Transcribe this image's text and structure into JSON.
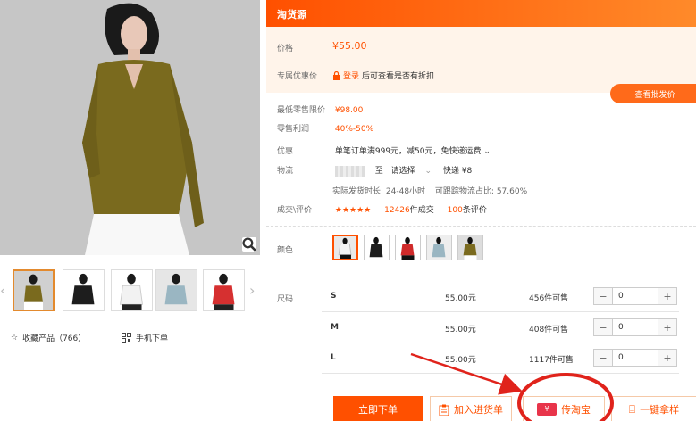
{
  "product": {
    "source_title": "淘货源",
    "price_label": "价格",
    "price": "¥55.00",
    "promo_label": "专属优惠价",
    "login_link": "登录",
    "login_hint": "后可查看是否有折扣",
    "wholesale_button": "查看批发价",
    "min_retail_label": "最低零售限价",
    "min_retail": "¥98.00",
    "margin_label": "零售利润",
    "margin": "40%-50%",
    "discount_label": "优惠",
    "discount_text": "单笔订单满999元，减50元，免快递运费",
    "shipping_label": "物流",
    "shipping_to": "至",
    "shipping_select": "请选择",
    "shipping_fee": "快递 ¥8",
    "delivery_time": "实际发货时长: 24-48小时",
    "trace_rate": "可跟踪物流占比: 57.60%",
    "deals_label": "成交\\评价",
    "deals_count": "12426",
    "deals_unit": "件成交",
    "reviews_count": "100",
    "reviews_unit": "条评价",
    "color_label": "颜色",
    "size_label": "尺码",
    "rating": 4.5
  },
  "sizes": [
    {
      "size": "S",
      "price": "55.00元",
      "available": "456件可售",
      "qty": "0"
    },
    {
      "size": "M",
      "price": "55.00元",
      "available": "408件可售",
      "qty": "0"
    },
    {
      "size": "L",
      "price": "55.00元",
      "available": "1117件可售",
      "qty": "0"
    }
  ],
  "left": {
    "favorite_label": "收藏产品（766）",
    "mobile_label": "手机下单"
  },
  "actions": {
    "buy_now": "立即下单",
    "add_cart": "加入进货单",
    "taobao": "传淘宝",
    "sample": "一键拿样"
  },
  "thumbs": [
    {
      "color": "#7a6a1e",
      "name": "olive"
    },
    {
      "color": "#1d1d1d",
      "name": "black"
    },
    {
      "color": "#f4f4f4",
      "name": "white"
    },
    {
      "color": "#9ab6c2",
      "name": "light-blue"
    },
    {
      "color": "#d63030",
      "name": "red"
    }
  ],
  "swatches": [
    {
      "color": "#f0f0f0",
      "name": "white"
    },
    {
      "color": "#1d1d1d",
      "name": "black"
    },
    {
      "color": "#cf2a2a",
      "name": "red"
    },
    {
      "color": "#9ab6c2",
      "name": "light-blue"
    },
    {
      "color": "#7a6a1e",
      "name": "olive"
    }
  ],
  "colors": {
    "accent": "#ff5000",
    "annotation": "#e0231b"
  }
}
